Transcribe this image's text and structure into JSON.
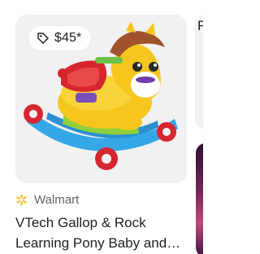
{
  "product_card": {
    "price": "$45*",
    "merchant": "Walmart",
    "title": "VTech Gallop & Rock Learning Pony Baby and Toddler Toy",
    "image_alt": "VTech Gallop & Rock Learning Pony"
  },
  "next_card": {
    "title_fragment": "F"
  },
  "icons": {
    "price_tag": "tag-icon",
    "merchant_logo": "walmart-spark-icon"
  },
  "colors": {
    "walmart_spark": "#f5b400",
    "card_background": "#f1f1f1"
  }
}
